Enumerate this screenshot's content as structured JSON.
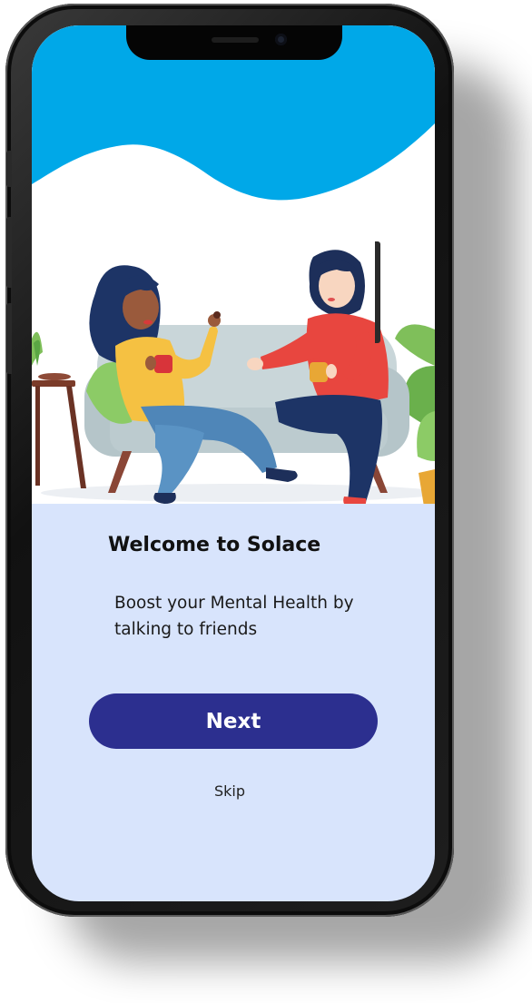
{
  "screen": {
    "title": "Welcome to Solace",
    "subtitle": "Boost your Mental Health by talking to friends",
    "next_label": "Next",
    "skip_label": "Skip"
  },
  "colors": {
    "wave": "#00a8e8",
    "background": "#d8e4fc",
    "button": "#2c2f8f",
    "button_text": "#ffffff"
  },
  "illustration": {
    "subject": "two-women-talking-on-sofa-illustration"
  }
}
